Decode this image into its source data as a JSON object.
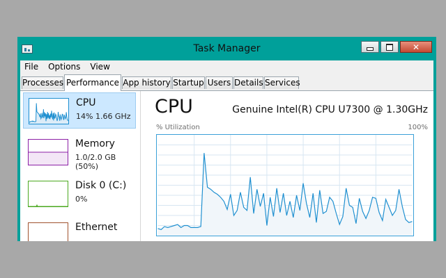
{
  "window": {
    "title": "Task Manager"
  },
  "menu": [
    "File",
    "Options",
    "View"
  ],
  "tabs": [
    "Processes",
    "Performance",
    "App history",
    "Startup",
    "Users",
    "Details",
    "Services"
  ],
  "active_tab": "Performance",
  "resources": [
    {
      "name": "CPU",
      "value": "14%  1.66 GHz",
      "color": "#1e8fd0"
    },
    {
      "name": "Memory",
      "value": "1.0/2.0 GB (50%)",
      "color": "#8b1ea6"
    },
    {
      "name": "Disk 0 (C:)",
      "value": "0%",
      "color": "#4aa81e"
    },
    {
      "name": "Ethernet",
      "value": "",
      "color": "#a0522d"
    }
  ],
  "detail": {
    "title": "CPU",
    "processor": "Genuine Intel(R) CPU U7300 @ 1.30GHz",
    "y_axis_label": "% Utilization",
    "y_axis_max": "100%",
    "utilization_history": [
      7,
      6,
      9,
      8,
      9,
      10,
      11,
      8,
      10,
      10,
      8,
      8,
      8,
      9,
      82,
      48,
      46,
      43,
      41,
      38,
      34,
      26,
      41,
      20,
      25,
      43,
      28,
      25,
      58,
      22,
      46,
      29,
      42,
      10,
      38,
      19,
      47,
      23,
      42,
      20,
      34,
      18,
      40,
      25,
      52,
      32,
      18,
      42,
      13,
      45,
      22,
      24,
      38,
      34,
      22,
      11,
      19,
      47,
      30,
      28,
      12,
      37,
      24,
      17,
      25,
      38,
      37,
      23,
      15,
      36,
      28,
      20,
      25,
      46,
      29,
      16,
      13,
      14
    ]
  },
  "colors": {
    "accent": "#00a09a",
    "graph_line": "#1e8fd0",
    "graph_fill": "#f1f6fa",
    "grid": "#d7e6f2"
  }
}
